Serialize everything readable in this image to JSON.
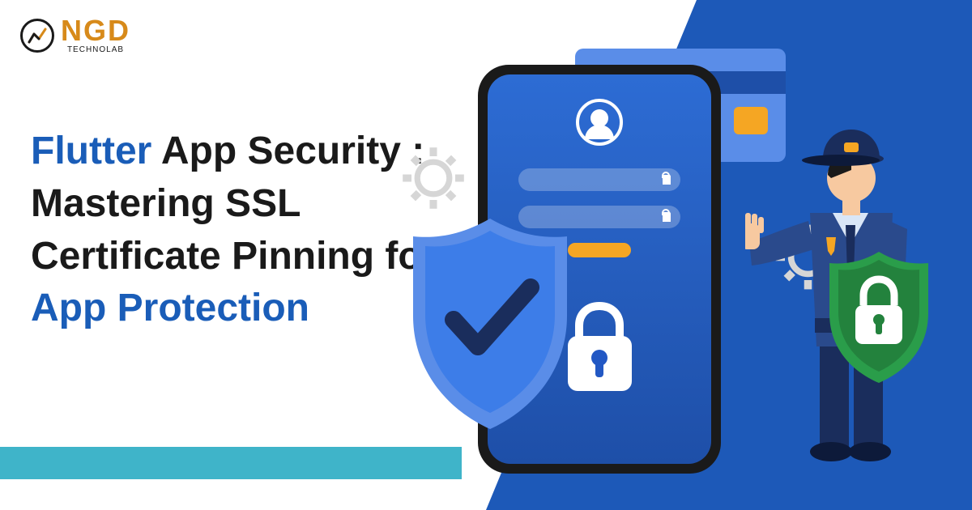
{
  "logo": {
    "name": "NGD",
    "tagline": "TECHNOLAB"
  },
  "headline": {
    "part1": "Flutter",
    "part2": " App Security : Mastering SSL Certificate Pinning for ",
    "part3": "App Protection"
  },
  "colors": {
    "brand_orange": "#d78a1a",
    "accent_blue": "#1a5db8",
    "teal": "#3fb4c9",
    "phone_blue": "#2258c4",
    "shield_blue": "#3d7de8",
    "shield_green": "#2a9d4a",
    "officer_navy": "#1a2d5c",
    "btn_orange": "#f5a623"
  },
  "icons": {
    "logo": "chart-circle-icon",
    "avatar": "user-icon",
    "field_lock": "lock-icon",
    "screen_lock": "padlock-icon",
    "shield_check": "shield-check-icon",
    "shield_lock": "shield-lock-icon",
    "gear": "gear-icon"
  }
}
